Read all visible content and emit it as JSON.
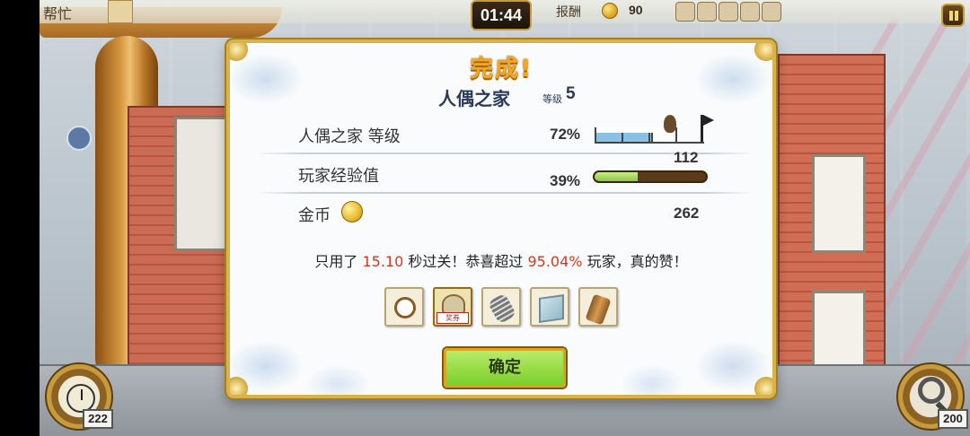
{
  "topbar": {
    "help_label": "帮忙",
    "timer": "01:44",
    "reward_label": "报酬",
    "reward_value": "90"
  },
  "tools": {
    "left_count": "222",
    "right_count": "200"
  },
  "dialog": {
    "title": "完成!",
    "scene_name": "人偶之家",
    "level_label": "等级",
    "level_value": "5",
    "rows": [
      {
        "label": "人偶之家  等级",
        "percent": "72%",
        "progress": 0.72
      },
      {
        "label": "玩家经验值",
        "percent": "39%",
        "value": "112",
        "progress": 0.39
      },
      {
        "label": "金币",
        "value": "262"
      }
    ],
    "summary": {
      "prefix": "只用了 ",
      "time": "15.10",
      "middle": " 秒过关！恭喜超过 ",
      "percent": "95.04%",
      "suffix": " 玩家，真的赞！"
    },
    "items": [
      {
        "icon": "pocket-watch-icon"
      },
      {
        "icon": "ticket-icon",
        "tag": "奖券"
      },
      {
        "icon": "spring-icon"
      },
      {
        "icon": "map-icon"
      },
      {
        "icon": "wood-log-icon"
      }
    ],
    "confirm_label": "确定"
  },
  "colors": {
    "title": "#f2a71e",
    "highlight": "#d23a1e",
    "confirm": "#8ed43c",
    "frame": "#d9b24a"
  }
}
